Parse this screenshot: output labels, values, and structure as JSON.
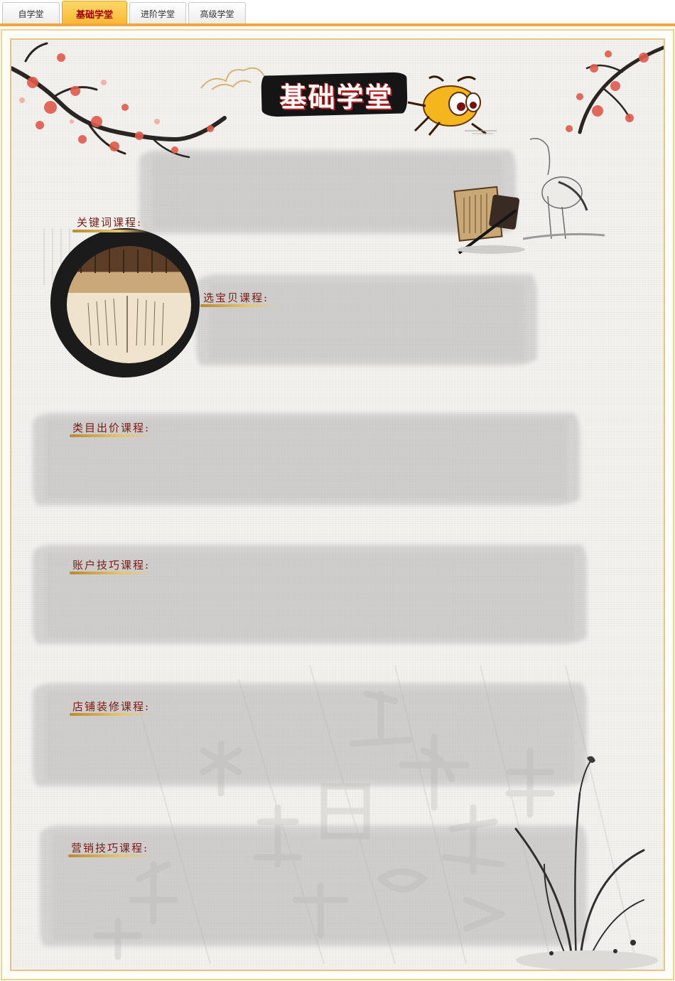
{
  "tabs": [
    {
      "label": "自学堂",
      "active": false
    },
    {
      "label": "基础学堂",
      "active": true
    },
    {
      "label": "进阶学堂",
      "active": false
    },
    {
      "label": "高级学堂",
      "active": false
    }
  ],
  "header": {
    "title": "基础学堂"
  },
  "sections": [
    {
      "label": "关键词课程:"
    },
    {
      "label": "选宝贝课程:"
    },
    {
      "label": "类目出价课程:"
    },
    {
      "label": "账户技巧课程:"
    },
    {
      "label": "店铺装修课程:"
    },
    {
      "label": "营销技巧课程:"
    }
  ],
  "colors": {
    "tab_active_bg": "#f9b530",
    "tab_active_text": "#a30000",
    "tab_bar_line": "#f0a63a",
    "frame_border": "#e7c585",
    "label_text": "#7a1b13"
  }
}
